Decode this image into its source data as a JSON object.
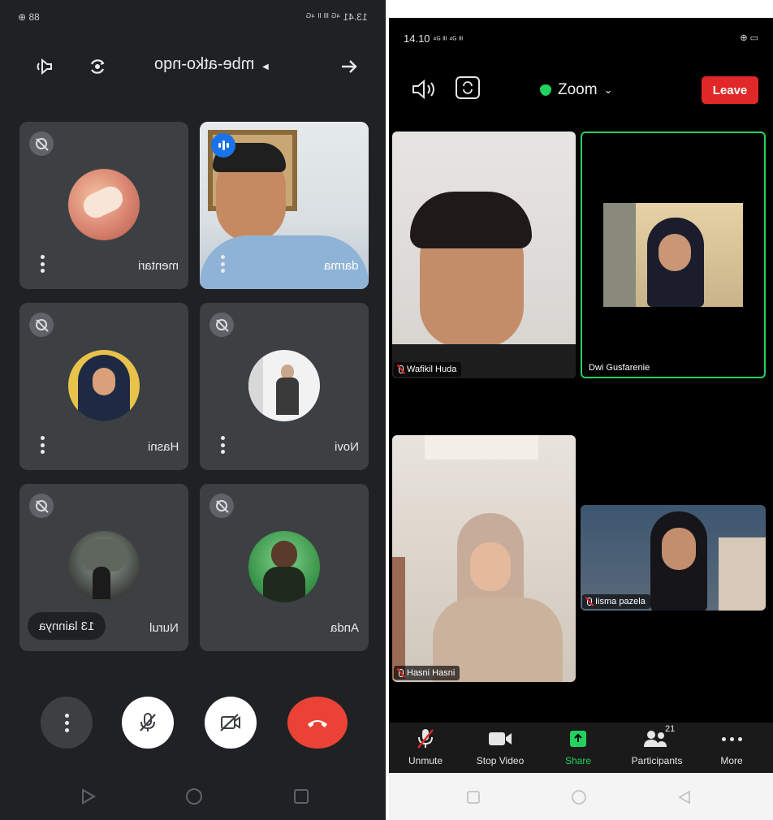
{
  "left": {
    "status": {
      "left": "88 ⊕",
      "right": "13.41 ⁴ᴳ ᴵᴵᴵ ᴵᴵ ⁴ᴳ"
    },
    "meeting_code": "mbe-atko-nqo",
    "tiles": [
      {
        "name": "mentari",
        "muted": true
      },
      {
        "name": "darma",
        "muted": false,
        "speaking": true
      },
      {
        "name": "Hasni",
        "muted": true
      },
      {
        "name": "Novi",
        "muted": true
      },
      {
        "name": "Nurul",
        "muted": true,
        "more": "13 lainnya"
      },
      {
        "name": "Anda",
        "muted": true
      }
    ],
    "controls": [
      "more-options",
      "microphone-off",
      "camera-off",
      "end-call"
    ],
    "colors": {
      "background": "#202124",
      "tile": "#3c4043",
      "end_call": "#ea4335"
    }
  },
  "right": {
    "status": {
      "time": "14.10",
      "signal": "⁴ᴳ ᴵᴵᴵ ⁴ᴳ ᴵᴵᴵ",
      "battery": "⊕ ▭"
    },
    "app_title": "Zoom",
    "leave_label": "Leave",
    "participants": [
      {
        "name": "Wafikil Huda",
        "muted": true
      },
      {
        "name": "Dwi Gusfarenie",
        "muted": false,
        "active_speaker": true
      },
      {
        "name": "Hasni Hasni",
        "muted": true
      },
      {
        "name": "Iisma pazela",
        "muted": true
      }
    ],
    "toolbar": [
      {
        "label": "Unmute",
        "icon": "mic-off-icon"
      },
      {
        "label": "Stop Video",
        "icon": "video-icon"
      },
      {
        "label": "Share",
        "icon": "share-icon"
      },
      {
        "label": "Participants",
        "icon": "participants-icon",
        "badge": "21"
      },
      {
        "label": "More",
        "icon": "more-icon"
      }
    ],
    "colors": {
      "leave": "#e02828",
      "share": "#23d160",
      "active_border": "#23d160"
    }
  }
}
